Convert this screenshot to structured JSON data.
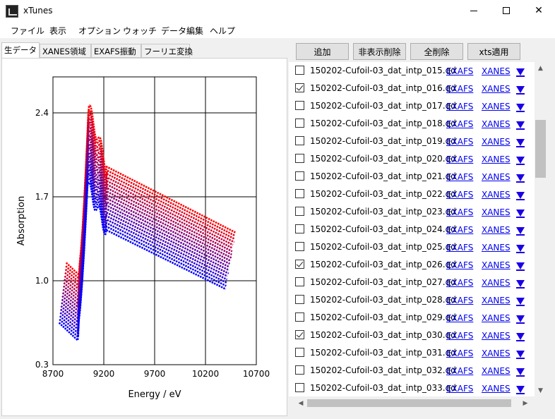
{
  "window": {
    "title": "xTunes"
  },
  "menu": [
    "ファイル",
    "表示",
    "オプション",
    "ウォッチ",
    "データ編集",
    "ヘルプ"
  ],
  "tabs": [
    "生データ",
    "XANES領域",
    "EXAFS振動",
    "フーリエ変換"
  ],
  "toolbar": {
    "add": "追加",
    "remove_hidden": "非表示削除",
    "remove_all": "全削除",
    "xts_apply": "xts適用"
  },
  "links": {
    "exafs": "EXAFS",
    "xanes": "XANES"
  },
  "files": [
    {
      "name": "150202-Cufoil-03_dat_intp_015.qd",
      "checked": false
    },
    {
      "name": "150202-Cufoil-03_dat_intp_016.qd",
      "checked": true
    },
    {
      "name": "150202-Cufoil-03_dat_intp_017.qd",
      "checked": false
    },
    {
      "name": "150202-Cufoil-03_dat_intp_018.qd",
      "checked": false
    },
    {
      "name": "150202-Cufoil-03_dat_intp_019.qd",
      "checked": false
    },
    {
      "name": "150202-Cufoil-03_dat_intp_020.qd",
      "checked": false
    },
    {
      "name": "150202-Cufoil-03_dat_intp_021.qd",
      "checked": false
    },
    {
      "name": "150202-Cufoil-03_dat_intp_022.qd",
      "checked": false
    },
    {
      "name": "150202-Cufoil-03_dat_intp_023.qd",
      "checked": false
    },
    {
      "name": "150202-Cufoil-03_dat_intp_024.qd",
      "checked": false
    },
    {
      "name": "150202-Cufoil-03_dat_intp_025.qd",
      "checked": false
    },
    {
      "name": "150202-Cufoil-03_dat_intp_026.qd",
      "checked": true
    },
    {
      "name": "150202-Cufoil-03_dat_intp_027.qd",
      "checked": false
    },
    {
      "name": "150202-Cufoil-03_dat_intp_028.qd",
      "checked": false
    },
    {
      "name": "150202-Cufoil-03_dat_intp_029.qd",
      "checked": false
    },
    {
      "name": "150202-Cufoil-03_dat_intp_030.qd",
      "checked": true
    },
    {
      "name": "150202-Cufoil-03_dat_intp_031.qd",
      "checked": false
    },
    {
      "name": "150202-Cufoil-03_dat_intp_032.qd",
      "checked": false
    },
    {
      "name": "150202-Cufoil-03_dat_intp_033.qd",
      "checked": false
    }
  ],
  "chart_data": {
    "type": "scatter",
    "xlabel": "Energy / eV",
    "ylabel": "Absorption",
    "xlim": [
      8700,
      10700
    ],
    "ylim": [
      0.3,
      2.7
    ],
    "xticks": [
      8700,
      9200,
      9700,
      10200,
      10700
    ],
    "xtick_labels": [
      "8700",
      "9200",
      "9700",
      "10200",
      "10700"
    ],
    "yticks": [
      0.3,
      1.0,
      1.7,
      2.4
    ],
    "ytick_labels": [
      "0.3",
      "1.0",
      "1.7",
      "2.4"
    ],
    "grid": true,
    "series_count": 19,
    "color_start": "#ff0000",
    "color_end": "#0000ff",
    "x_start_first": 8830,
    "x_start_last": 8760,
    "x_end_first": 10500,
    "x_end_last": 10400,
    "pre_edge_first": 1.15,
    "pre_edge_last": 0.65,
    "edge_x": 8980,
    "peak_first": 2.45,
    "peak_last": 1.8,
    "tail_first": 1.4,
    "tail_last": 0.93
  }
}
